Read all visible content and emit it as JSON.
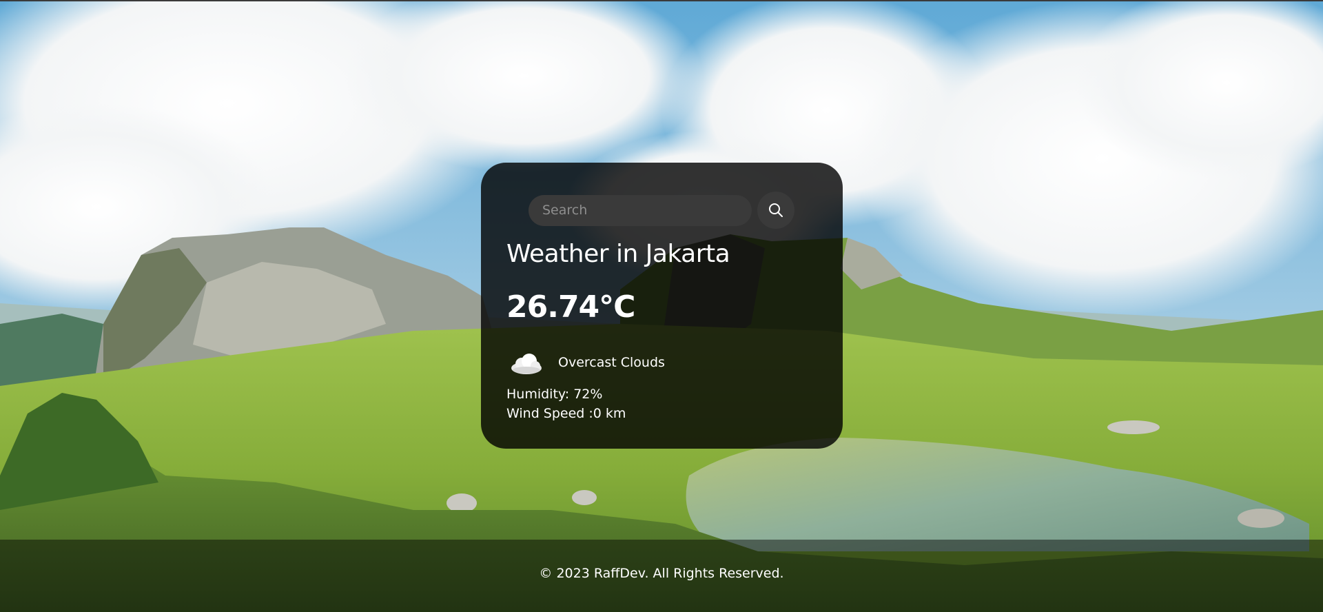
{
  "search": {
    "placeholder": "Search"
  },
  "weather": {
    "title": "Weather in Jakarta",
    "temperature": "26.74°C",
    "condition": "Overcast Clouds",
    "condition_icon": "cloud-icon",
    "humidity": "Humidity: 72%",
    "wind": "Wind Speed :0 km"
  },
  "footer": {
    "text": "© 2023 RaffDev. All Rights Reserved."
  },
  "colors": {
    "card_background": "#000000",
    "text": "#ffffff",
    "input_background": "#3a3a3a"
  }
}
